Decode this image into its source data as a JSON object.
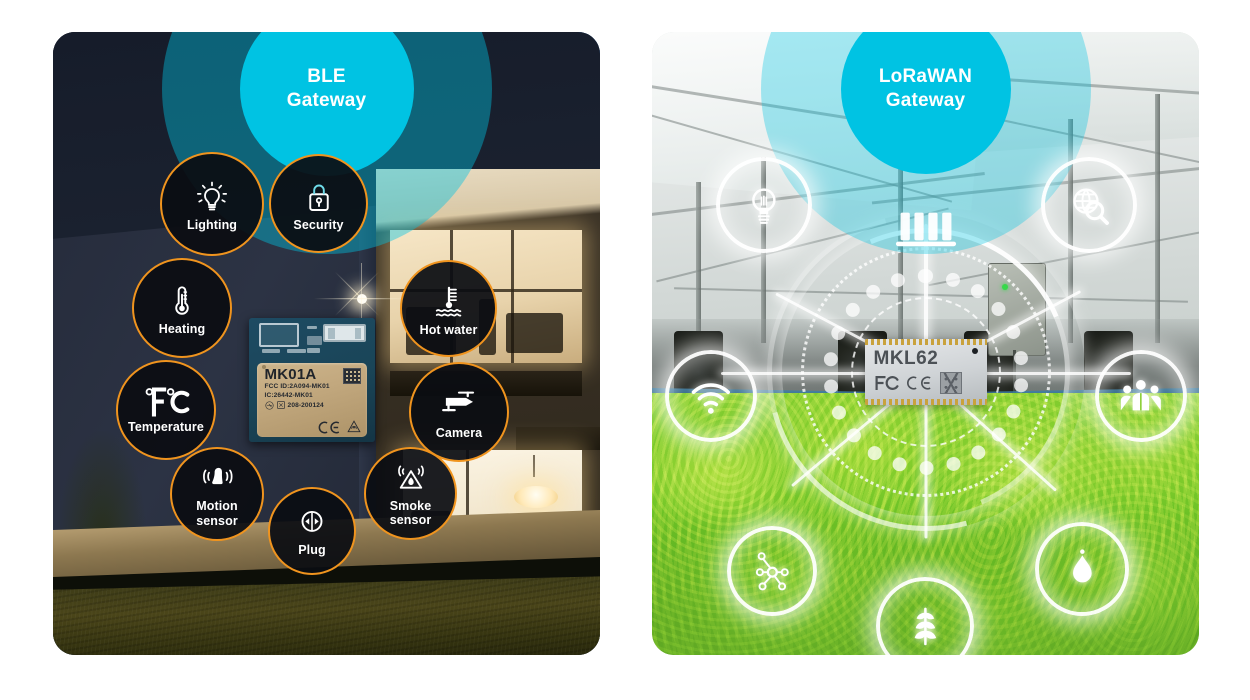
{
  "scene_left": {
    "name": "BLE smart home scenario",
    "gateway": {
      "line1": "BLE",
      "line2": "Gateway",
      "icon": "ble-gateway-icon"
    },
    "module": {
      "name": "MK01A",
      "fcc_id": "FCC ID:2A094-MK01",
      "ic_id": "IC:26442-MK01",
      "mic_id": "208-200124",
      "mark_ce": "CE",
      "mark_ratings": "R-NZ",
      "qr": "datamatrix-code"
    },
    "nodes": [
      {
        "label": "Lighting",
        "icon": "lightbulb-icon",
        "lines": 1
      },
      {
        "label": "Security",
        "icon": "padlock-icon",
        "lines": 1
      },
      {
        "label": "Heating",
        "icon": "thermometer-icon",
        "lines": 1
      },
      {
        "label": "Hot water",
        "icon": "water-heater-icon",
        "lines": 1
      },
      {
        "label": "Temperature",
        "icon": "fahrenheit-celsius-icon",
        "lines": 1
      },
      {
        "label": "Camera",
        "icon": "cctv-camera-icon",
        "lines": 1
      },
      {
        "label": "Motion\nsensor",
        "icon": "motion-sensor-icon",
        "lines": 2,
        "l1": "Motion",
        "l2": "sensor"
      },
      {
        "label": "Plug",
        "icon": "power-socket-icon",
        "lines": 1
      },
      {
        "label": "Smoke\nsensor",
        "icon": "smoke-alarm-icon",
        "lines": 2,
        "l1": "Smoke",
        "l2": "sensor"
      }
    ]
  },
  "scene_right": {
    "name": "LoRaWAN smart agriculture scenario",
    "gateway": {
      "line1": "LoRaWAN",
      "line2": "Gateway",
      "icon": "lorawan-gateway-icon"
    },
    "module": {
      "name": "MKL62",
      "mark_fcc": "FC",
      "mark_ce": "CE",
      "logo": "mokosmart-logo"
    },
    "nodes": [
      {
        "icon": "lightbulb-icon"
      },
      {
        "icon": "globe-search-icon"
      },
      {
        "icon": "wifi-icon"
      },
      {
        "icon": "people-group-icon"
      },
      {
        "icon": "network-nodes-icon"
      },
      {
        "icon": "water-drop-icon"
      },
      {
        "icon": "plant-leaf-icon"
      }
    ]
  },
  "colors": {
    "accent_cyan": "#00c3e3",
    "accent_orange": "#f0941e",
    "node_fill_dark": "#0b0d12",
    "glow_white": "#ffffff",
    "panel_left_bg": "#11161f",
    "crop_green": "#8bd033"
  }
}
